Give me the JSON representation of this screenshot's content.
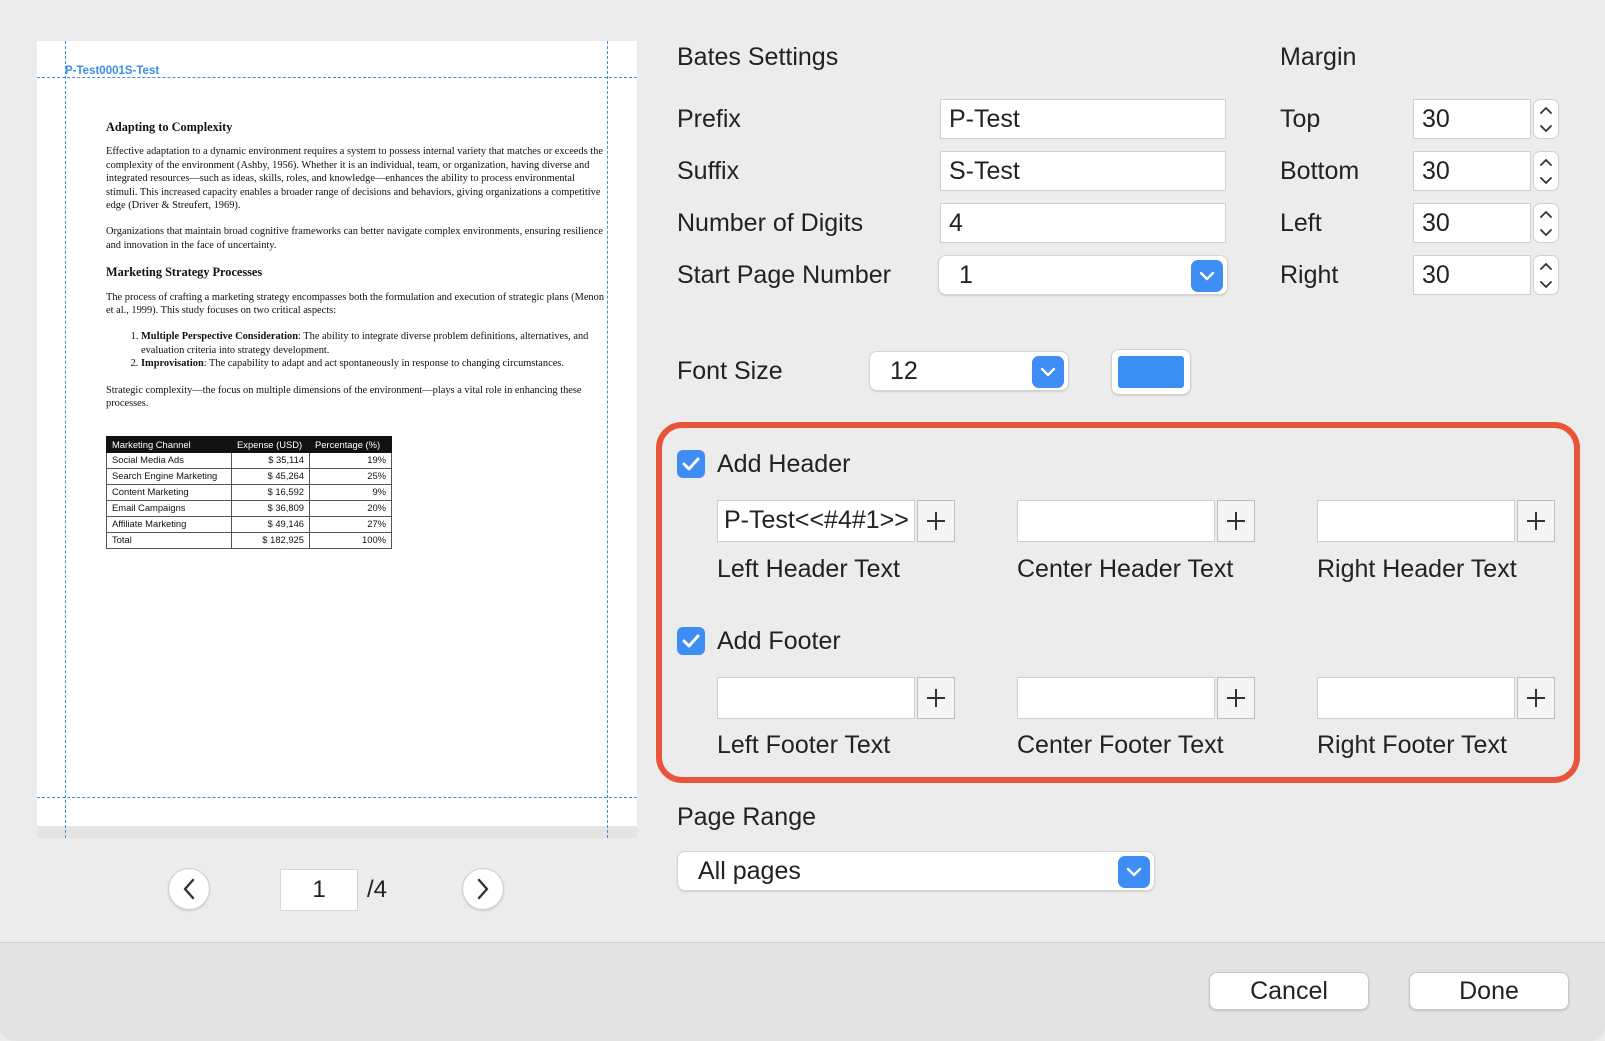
{
  "preview": {
    "bates_stamp": "P-Test0001S-Test",
    "doc": {
      "h1": "Adapting to Complexity",
      "p1": "Effective adaptation to a dynamic environment requires a system to possess internal variety that matches or exceeds the complexity of the environment (Ashby, 1956). Whether it is an individual, team, or organization, having diverse and integrated resources—such as ideas, skills, roles, and knowledge—enhances the ability to process environmental stimuli. This increased capacity enables a broader range of decisions and behaviors, giving organizations a competitive edge (Driver & Streufert, 1969).",
      "p2": "Organizations that maintain broad cognitive frameworks can better navigate complex environments, ensuring resilience and innovation in the face of uncertainty.",
      "h2": "Marketing Strategy Processes",
      "p3": "The process of crafting a marketing strategy encompasses both the formulation and execution of strategic plans (Menon et al., 1999). This study focuses on two critical aspects:",
      "li1_bold": "Multiple Perspective Consideration",
      "li1_text": ": The ability to integrate diverse problem definitions, alternatives, and evaluation criteria into strategy development.",
      "li2_bold": "Improvisation",
      "li2_text": ": The capability to adapt and act spontaneously in response to changing circumstances.",
      "p4": "Strategic complexity—the focus on multiple dimensions of the environment—plays a vital role in enhancing these processes.",
      "table": {
        "headers": [
          "Marketing Channel",
          "Expense (USD)",
          "Percentage (%)"
        ],
        "rows": [
          [
            "Social Media Ads",
            "$ 35,114",
            "19%"
          ],
          [
            "Search Engine Marketing",
            "$ 45,264",
            "25%"
          ],
          [
            "Content Marketing",
            "$ 16,592",
            "9%"
          ],
          [
            "Email Campaigns",
            "$ 36,809",
            "20%"
          ],
          [
            "Affiliate Marketing",
            "$ 49,146",
            "27%"
          ],
          [
            "Total",
            "$ 182,925",
            "100%"
          ]
        ]
      }
    },
    "page_current": "1",
    "page_total": "/4"
  },
  "bates": {
    "title": "Bates Settings",
    "prefix_label": "Prefix",
    "prefix_value": "P-Test",
    "suffix_label": "Suffix",
    "suffix_value": "S-Test",
    "digits_label": "Number of Digits",
    "digits_value": "4",
    "start_label": "Start Page Number",
    "start_value": "1"
  },
  "margin": {
    "title": "Margin",
    "top_label": "Top",
    "top_value": "30",
    "bottom_label": "Bottom",
    "bottom_value": "30",
    "left_label": "Left",
    "left_value": "30",
    "right_label": "Right",
    "right_value": "30"
  },
  "font": {
    "label": "Font Size",
    "value": "12",
    "color": "#3b8ff2"
  },
  "header": {
    "label": "Add Header",
    "checked": true,
    "left_value": "P-Test<<#4#1>>",
    "left_label": "Left Header Text",
    "center_value": "",
    "center_label": "Center Header Text",
    "right_value": "",
    "right_label": "Right Header Text"
  },
  "footer": {
    "label": "Add Footer",
    "checked": true,
    "left_value": "",
    "left_label": "Left Footer Text",
    "center_value": "",
    "center_label": "Center Footer Text",
    "right_value": "",
    "right_label": "Right Footer Text"
  },
  "page_range": {
    "label": "Page Range",
    "value": "All pages"
  },
  "buttons": {
    "cancel": "Cancel",
    "done": "Done"
  },
  "colors": {
    "accent": "#3d8df5",
    "highlight": "#e8553a",
    "guide": "#3b8fe0"
  }
}
